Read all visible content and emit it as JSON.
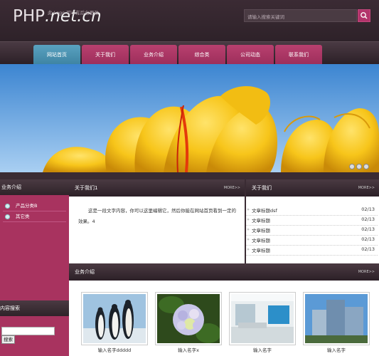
{
  "header": {
    "logo_main": "PHP",
    "logo_rest": ".net.cn",
    "logo_sub": "此 Logo 可以在后台更改",
    "search_placeholder": "请输入搜索关键词"
  },
  "nav": {
    "items": [
      "网站首页",
      "关于我们",
      "业务介绍",
      "综合类",
      "公司动态",
      "联系我们"
    ]
  },
  "sidebar": {
    "title": "业务介绍",
    "items": [
      "产品分类B",
      "其它类"
    ],
    "search_title": "内容搜索",
    "search_button": "搜索"
  },
  "about": {
    "title": "关于我们1",
    "more": "MORE>>",
    "text": "这是一段文字内容，你可以这里编辑它，然后你能在网站首页看到一定的效果。4"
  },
  "news": {
    "title": "关于我们",
    "more": "MORE>>",
    "items": [
      {
        "title": "文章标题dsf",
        "date": "02/13"
      },
      {
        "title": "文章标题",
        "date": "02/13"
      },
      {
        "title": "文章标题",
        "date": "02/13"
      },
      {
        "title": "文章标题",
        "date": "02/13"
      },
      {
        "title": "文章标题",
        "date": "02/13"
      }
    ]
  },
  "business": {
    "title": "业务介绍",
    "more": "MORE>>",
    "items": [
      {
        "caption": "输入名字ddddd"
      },
      {
        "caption": "输入名字x"
      },
      {
        "caption": "输入名字"
      },
      {
        "caption": "输入名字"
      }
    ]
  }
}
